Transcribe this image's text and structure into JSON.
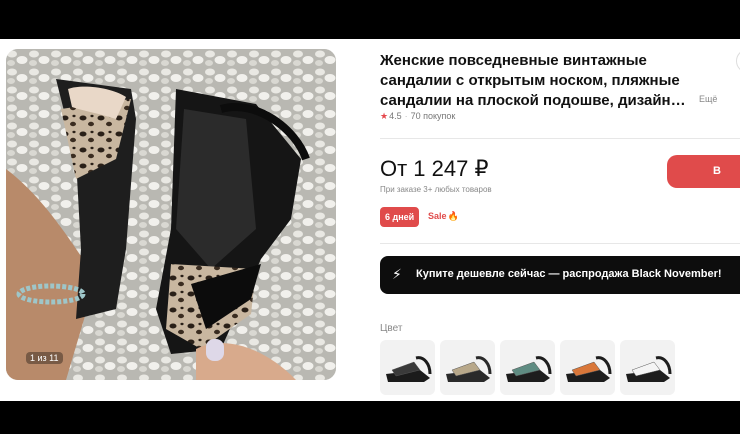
{
  "product": {
    "title": "Женские повседневные винтажные сандалии с открытым носком, пляжные сандалии на плоской подошве, дизайн…",
    "more_link": "Ещё",
    "rating": "4.5",
    "purchases": "70 покупок",
    "image_counter": "1 из 11"
  },
  "pricing": {
    "price": "От 1 247 ₽",
    "note": "При заказе 3+ любых товаров",
    "buy_button": "В корзину"
  },
  "badges": {
    "days": "6 дней",
    "sale": "Sale"
  },
  "promo": {
    "text": "Купите дешевле сейчас — распродажа Black November!"
  },
  "colors": {
    "label": "Цвет",
    "options": [
      {
        "name": "black",
        "strap": "#1b1b1b",
        "accent": "#3a3a3a"
      },
      {
        "name": "leopard",
        "strap": "#2a2a2a",
        "accent": "#b8a88a"
      },
      {
        "name": "green",
        "strap": "#1d1d1d",
        "accent": "#5f8c82"
      },
      {
        "name": "orange",
        "strap": "#1d1d1d",
        "accent": "#d9773a"
      },
      {
        "name": "white",
        "strap": "#1d1d1d",
        "accent": "#f4f4f4"
      }
    ]
  },
  "theme": {
    "accent": "#e04b4b",
    "promo_bg": "#0d0d0d"
  }
}
